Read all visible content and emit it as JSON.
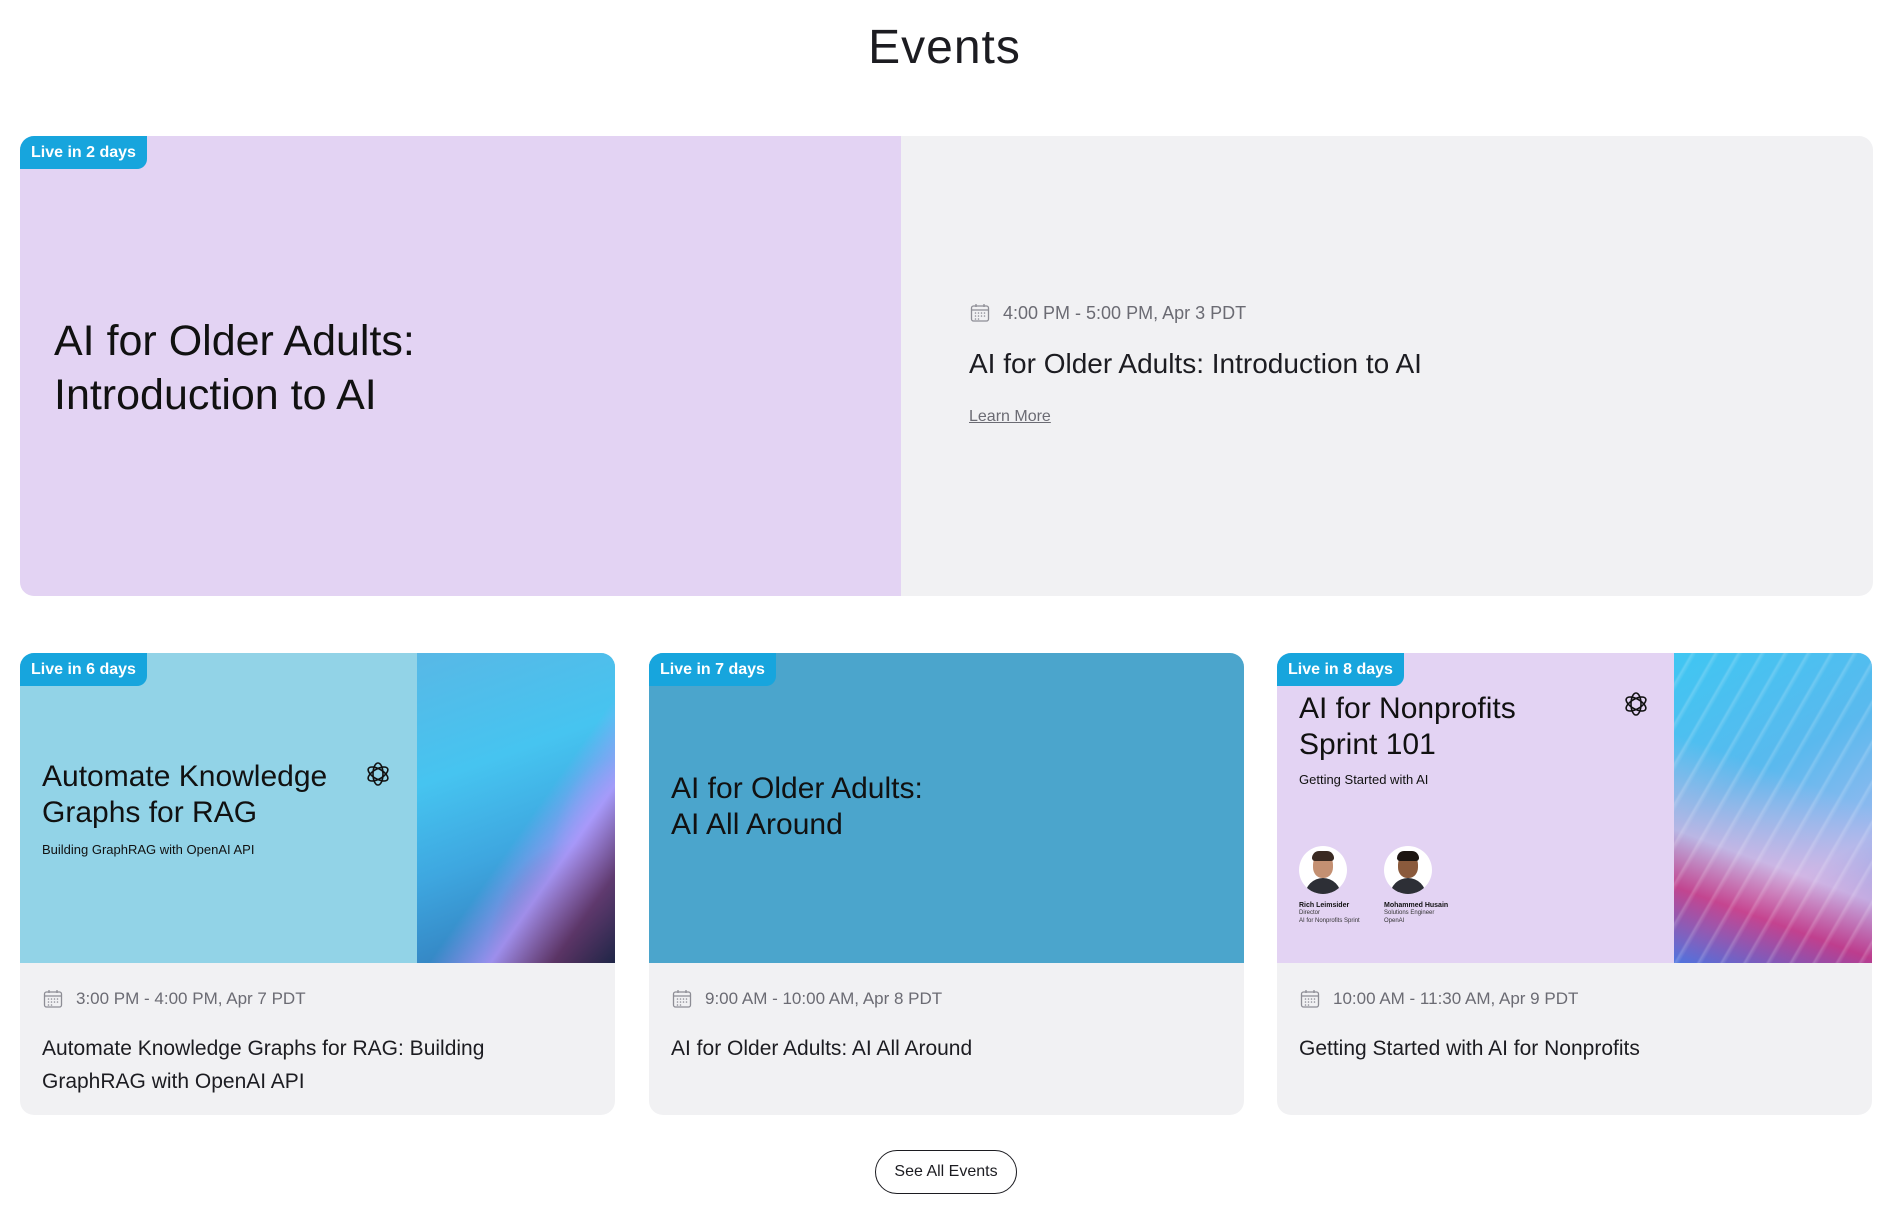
{
  "page": {
    "title": "Events"
  },
  "featured": {
    "badge": "Live in 2 days",
    "media_title_line1": "AI for Older Adults:",
    "media_title_line2": "Introduction to AI",
    "datetime": "4:00 PM - 5:00 PM, Apr 3 PDT",
    "name": "AI for Older Adults: Introduction to AI",
    "link_label": "Learn More",
    "media_color": "#e3d3f3"
  },
  "cards": [
    {
      "badge": "Live in 6 days",
      "media_title_line1": "Automate Knowledge",
      "media_title_line2": "Graphs for RAG",
      "media_subtitle": "Building GraphRAG with OpenAI API",
      "datetime": "3:00 PM - 4:00 PM, Apr 7 PDT",
      "name": "Automate Knowledge Graphs for RAG: Building GraphRAG with OpenAI API",
      "media_color": "#92d3e7"
    },
    {
      "badge": "Live in 7 days",
      "media_title_line1": "AI for Older Adults:",
      "media_title_line2": "AI All Around",
      "datetime": "9:00 AM - 10:00 AM, Apr 8 PDT",
      "name": "AI for Older Adults: AI All Around",
      "media_color": "#4ba5cc"
    },
    {
      "badge": "Live in 8 days",
      "media_title_line1": "AI for Nonprofits",
      "media_title_line2": "Sprint 101",
      "media_subtitle": "Getting Started with AI",
      "speakers": [
        {
          "name": "Rich Leimsider",
          "role1": "Director",
          "role2": "AI for Nonprofits Sprint"
        },
        {
          "name": "Mohammed Husain",
          "role1": "Solutions Engineer",
          "role2": "OpenAI"
        }
      ],
      "datetime": "10:00 AM - 11:30 AM, Apr 9 PDT",
      "name": "Getting Started with AI for Nonprofits",
      "media_color": "#e3d3f3"
    }
  ],
  "see_all_label": "See All Events",
  "colors": {
    "badge": "#17a5dd",
    "card_body": "#f1f1f3",
    "text": "#1c1c21",
    "muted": "#6b6b73"
  },
  "icons": {
    "calendar": "calendar-icon",
    "logo": "openai-logo-icon"
  }
}
